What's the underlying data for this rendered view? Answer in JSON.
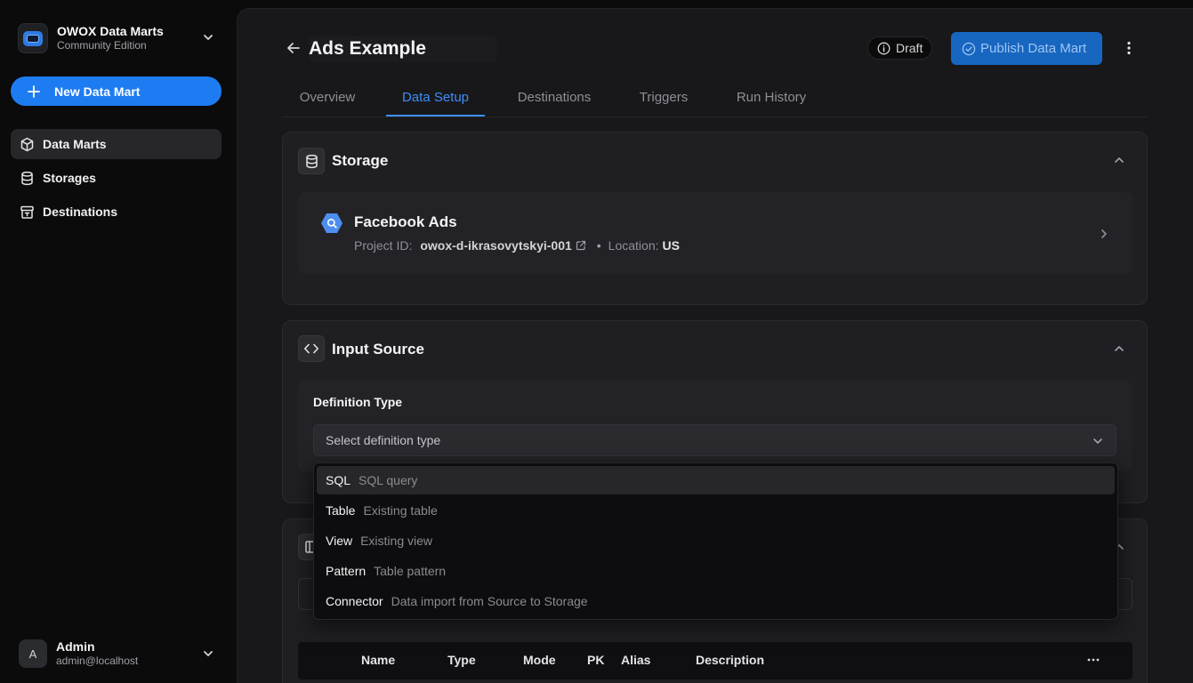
{
  "app": {
    "title": "OWOX Data Marts",
    "edition": "Community Edition",
    "new_button": "New Data Mart"
  },
  "sidebar": {
    "items": [
      {
        "label": "Data Marts",
        "icon": "cube-icon",
        "active": true
      },
      {
        "label": "Storages",
        "icon": "database-icon",
        "active": false
      },
      {
        "label": "Destinations",
        "icon": "archive-icon",
        "active": false
      }
    ]
  },
  "user": {
    "initial": "A",
    "name": "Admin",
    "email": "admin@localhost"
  },
  "header": {
    "title": "Ads Example",
    "status": "Draft",
    "publish_label": "Publish Data Mart"
  },
  "tabs": [
    {
      "label": "Overview",
      "active": false
    },
    {
      "label": "Data Setup",
      "active": true
    },
    {
      "label": "Destinations",
      "active": false
    },
    {
      "label": "Triggers",
      "active": false
    },
    {
      "label": "Run History",
      "active": false
    }
  ],
  "storage": {
    "section_title": "Storage",
    "name": "Facebook Ads",
    "project_label": "Project ID:",
    "project_id": "owox-d-ikrasovytskyi-001",
    "separator": "•",
    "location_label": "Location:",
    "location": "US"
  },
  "input_source": {
    "section_title": "Input Source",
    "definition_label": "Definition Type",
    "select_placeholder": "Select definition type"
  },
  "definition_options": [
    {
      "key": "SQL",
      "desc": "SQL query",
      "highlighted": true
    },
    {
      "key": "Table",
      "desc": "Existing table",
      "highlighted": false
    },
    {
      "key": "View",
      "desc": "Existing view",
      "highlighted": false
    },
    {
      "key": "Pattern",
      "desc": "Table pattern",
      "highlighted": false
    },
    {
      "key": "Connector",
      "desc": "Data import from Source to Storage",
      "highlighted": false
    }
  ],
  "schema_table": {
    "columns": [
      "Name",
      "Type",
      "Mode",
      "PK",
      "Alias",
      "Description"
    ]
  },
  "colors": {
    "accent": "#1d7cf2",
    "active_tab": "#3d8ef5",
    "publish": "#1766c0"
  }
}
